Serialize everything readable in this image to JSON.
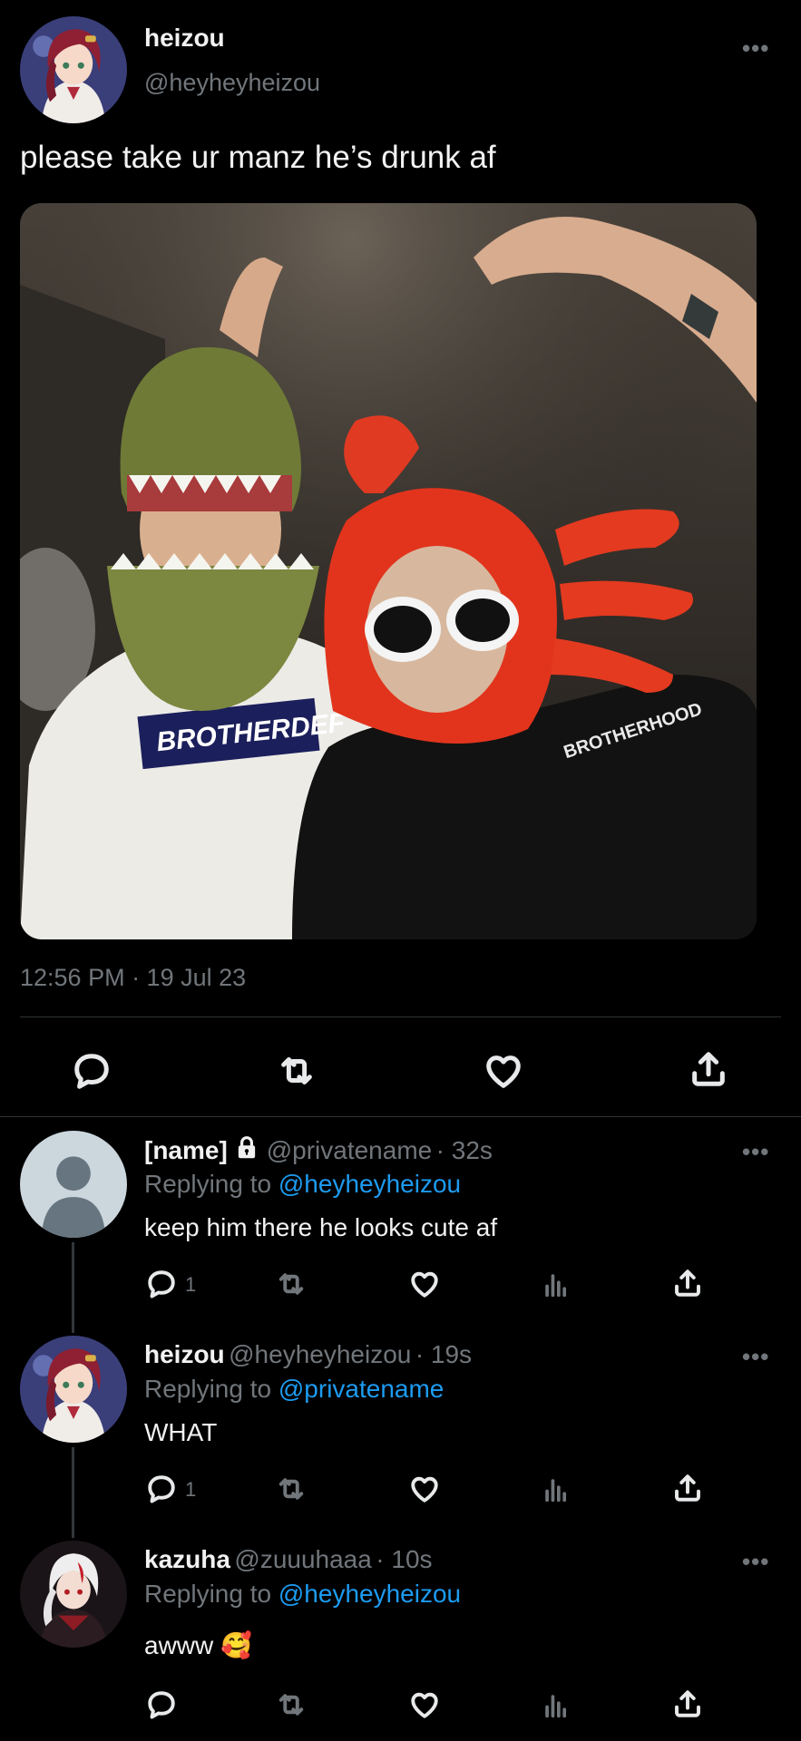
{
  "main_tweet": {
    "display_name": "heizou",
    "handle": "@heyheyheizou",
    "text": "please take ur manz he’s drunk af",
    "timestamp": "12:56 PM · 19 Jul 23",
    "avatar": "heizou-avatar",
    "photo_shirt_text_left": "BROTHERDEF",
    "photo_shirt_text_right": "BROTHERHOOD"
  },
  "main_actions": [
    "reply-icon",
    "retweet-icon",
    "like-icon",
    "share-icon"
  ],
  "replies": [
    {
      "display_name": "[name]",
      "lock": true,
      "handle": "@privatename",
      "time": "· 32s",
      "replying_prefix": "Replying to ",
      "replying_to": "@heyheyheizou",
      "text": "keep him there he looks cute af",
      "reply_count": "1"
    },
    {
      "display_name": "heizou",
      "handle": "@heyheyheizou",
      "time": "· 19s",
      "replying_prefix": "Replying to ",
      "replying_to": "@privatename",
      "text": "WHAT",
      "reply_count": "1"
    },
    {
      "display_name": "kazuha",
      "handle": "@zuuuhaaa",
      "time": "· 10s",
      "replying_prefix": "Replying to ",
      "replying_to": "@heyheyheizou",
      "text": "awww 🥰",
      "reply_count": ""
    }
  ],
  "colors": {
    "background": "#000000",
    "link": "#1d9bf0",
    "muted": "#71767b",
    "divider": "#2f3336"
  }
}
